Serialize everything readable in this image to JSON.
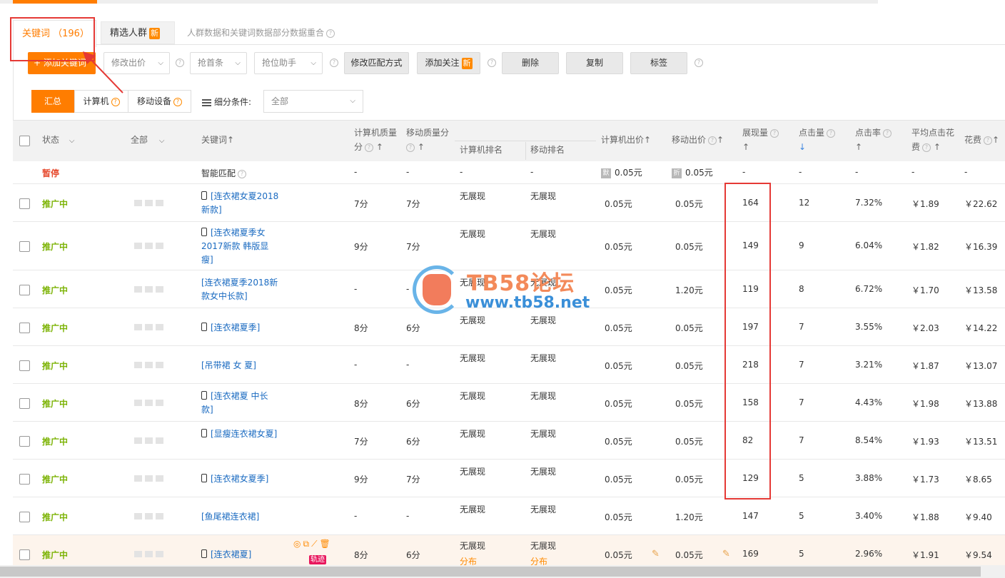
{
  "tabs": {
    "keywords": "关键词 （196）",
    "crowd": "精选人群",
    "crowd_badge": "新",
    "note": "人群数据和关键词数据部分数据重合"
  },
  "toolbar": {
    "add": "+ 添加关键词",
    "modify_price": "修改出价",
    "grab_top": "抢首条",
    "grab_assistant": "抢位助手",
    "modify_match": "修改匹配方式",
    "add_follow": "添加关注",
    "add_follow_badge": "新",
    "delete": "删除",
    "copy": "复制",
    "tag": "标签"
  },
  "filter": {
    "summary": "汇总",
    "computer": "计算机",
    "mobile": "移动设备",
    "segment_label": "细分条件:",
    "segment_value": "全部"
  },
  "headers": {
    "status": "状态",
    "all": "全部",
    "keyword": "关键词↑",
    "pc_quality_1": "计算机质量",
    "pc_quality_2": "分",
    "mobile_quality": "移动质量分",
    "pc_rank": "计算机排名",
    "mobile_rank": "移动排名",
    "pc_bid": "计算机出价↑",
    "mobile_bid": "移动出价",
    "impressions": "展现量",
    "clicks": "点击量",
    "ctr": "点击率",
    "avg_cpc_1": "平均点击花",
    "avg_cpc_2": "费",
    "cost": "花费"
  },
  "smart_row": {
    "status": "暂停",
    "keyword": "智能匹配",
    "pc_quality": "-",
    "mobile_quality": "-",
    "pc_rank": "-",
    "mobile_rank": "-",
    "pc_tag": "默",
    "pc_bid": "0.05元",
    "mobile_tag": "折",
    "mobile_bid": "0.05元",
    "impressions": "-",
    "clicks": "-",
    "ctr": "-",
    "avg_cpc": "-",
    "cost": "-"
  },
  "rows": [
    {
      "status": "推广中",
      "keyword": "[连衣裙女夏2018新款]",
      "pc_quality": "7分",
      "mobile_quality": "7分",
      "pc_rank": "无展现",
      "mobile_rank": "无展现",
      "pc_bid": "0.05元",
      "mobile_bid": "0.05元",
      "impressions": "164",
      "clicks": "12",
      "ctr": "7.32%",
      "avg_cpc": "￥1.89",
      "cost": "￥22.62"
    },
    {
      "status": "推广中",
      "keyword": "[连衣裙夏季女2017新款 韩版显瘦]",
      "pc_quality": "9分",
      "mobile_quality": "7分",
      "pc_rank": "无展现",
      "mobile_rank": "无展现",
      "pc_bid": "0.05元",
      "mobile_bid": "0.05元",
      "impressions": "149",
      "clicks": "9",
      "ctr": "6.04%",
      "avg_cpc": "￥1.82",
      "cost": "￥16.39"
    },
    {
      "status": "推广中",
      "keyword": "[连衣裙夏季2018新款女中长款]",
      "pc_quality": "-",
      "mobile_quality": "-",
      "pc_rank": "无展现",
      "mobile_rank": "无展现",
      "pc_bid": "0.05元",
      "mobile_bid": "1.20元",
      "impressions": "119",
      "clicks": "8",
      "ctr": "6.72%",
      "avg_cpc": "￥1.70",
      "cost": "￥13.58"
    },
    {
      "status": "推广中",
      "keyword": "[连衣裙夏季]",
      "pc_quality": "8分",
      "mobile_quality": "6分",
      "pc_rank": "无展现",
      "mobile_rank": "无展现",
      "pc_bid": "0.05元",
      "mobile_bid": "0.05元",
      "impressions": "197",
      "clicks": "7",
      "ctr": "3.55%",
      "avg_cpc": "￥2.03",
      "cost": "￥14.22"
    },
    {
      "status": "推广中",
      "keyword": "[吊带裙 女 夏]",
      "pc_quality": "-",
      "mobile_quality": "-",
      "pc_rank": "无展现",
      "mobile_rank": "无展现",
      "pc_bid": "0.05元",
      "mobile_bid": "0.05元",
      "impressions": "218",
      "clicks": "7",
      "ctr": "3.21%",
      "avg_cpc": "￥1.87",
      "cost": "￥13.07"
    },
    {
      "status": "推广中",
      "keyword": "[连衣裙夏 中长款]",
      "pc_quality": "8分",
      "mobile_quality": "6分",
      "pc_rank": "无展现",
      "mobile_rank": "无展现",
      "pc_bid": "0.05元",
      "mobile_bid": "0.05元",
      "impressions": "158",
      "clicks": "7",
      "ctr": "4.43%",
      "avg_cpc": "￥1.98",
      "cost": "￥13.88"
    },
    {
      "status": "推广中",
      "keyword": "[显瘦连衣裙女夏]",
      "pc_quality": "7分",
      "mobile_quality": "6分",
      "pc_rank": "无展现",
      "mobile_rank": "无展现",
      "pc_bid": "0.05元",
      "mobile_bid": "0.05元",
      "impressions": "82",
      "clicks": "7",
      "ctr": "8.54%",
      "avg_cpc": "￥1.93",
      "cost": "￥13.51"
    },
    {
      "status": "推广中",
      "keyword": "[连衣裙女夏季]",
      "pc_quality": "9分",
      "mobile_quality": "7分",
      "pc_rank": "无展现",
      "mobile_rank": "无展现",
      "pc_bid": "0.05元",
      "mobile_bid": "0.05元",
      "impressions": "129",
      "clicks": "5",
      "ctr": "3.88%",
      "avg_cpc": "￥1.73",
      "cost": "￥8.65"
    },
    {
      "status": "推广中",
      "keyword": "[鱼尾裙连衣裙]",
      "pc_quality": "-",
      "mobile_quality": "-",
      "pc_rank": "无展现",
      "mobile_rank": "无展现",
      "pc_bid": "0.05元",
      "mobile_bid": "1.20元",
      "impressions": "147",
      "clicks": "5",
      "ctr": "3.40%",
      "avg_cpc": "￥1.88",
      "cost": "￥9.40"
    },
    {
      "status": "推广中",
      "keyword": "[连衣裙夏]",
      "pc_quality": "8分",
      "mobile_quality": "6分",
      "pc_rank": "无展现",
      "mobile_rank": "无展现",
      "pc_rank_sub": "分布",
      "mobile_rank_sub": "分布",
      "pc_bid": "0.05元",
      "mobile_bid": "0.05元",
      "impressions": "169",
      "clicks": "5",
      "ctr": "2.96%",
      "avg_cpc": "￥1.91",
      "cost": "￥9.54",
      "track": "轨迹"
    }
  ],
  "watermark": {
    "title": "TB58论坛",
    "url": "www.tb58.net"
  },
  "colors": {
    "accent": "#ff7d00",
    "status_active": "#7cb305",
    "status_paused": "#e64a2e",
    "keyword_link": "#1b6bc1",
    "annotation_red": "#e53935"
  }
}
